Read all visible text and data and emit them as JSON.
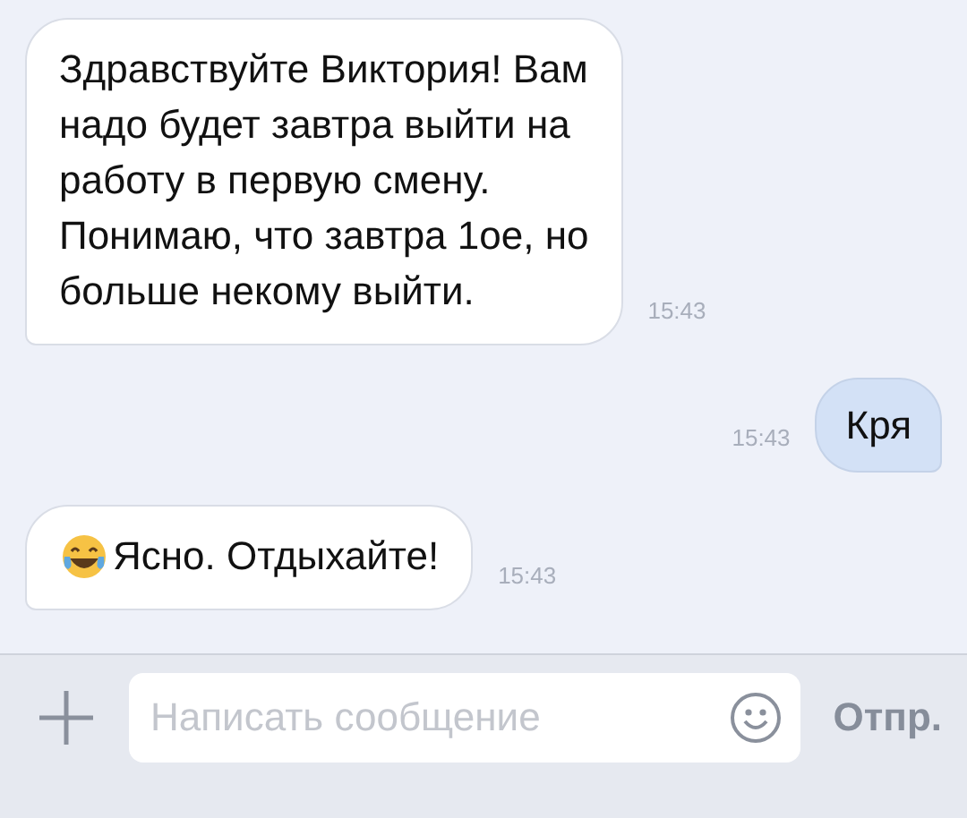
{
  "messages": [
    {
      "kind": "in",
      "text": "Здравствуйте Виктория! Вам\nнадо будет завтра выйти на\nработу в первую смену.\nПонимаю, что завтра 1ое, но\nбольше некому выйти.",
      "time": "15:43",
      "emoji": false
    },
    {
      "kind": "out",
      "text": "Кря",
      "time": "15:43",
      "emoji": false
    },
    {
      "kind": "in",
      "text": "Ясно. Отдыхайте!",
      "time": "15:43",
      "emoji": true
    }
  ],
  "composer": {
    "placeholder": "Написать сообщение",
    "send": "Отпр."
  }
}
